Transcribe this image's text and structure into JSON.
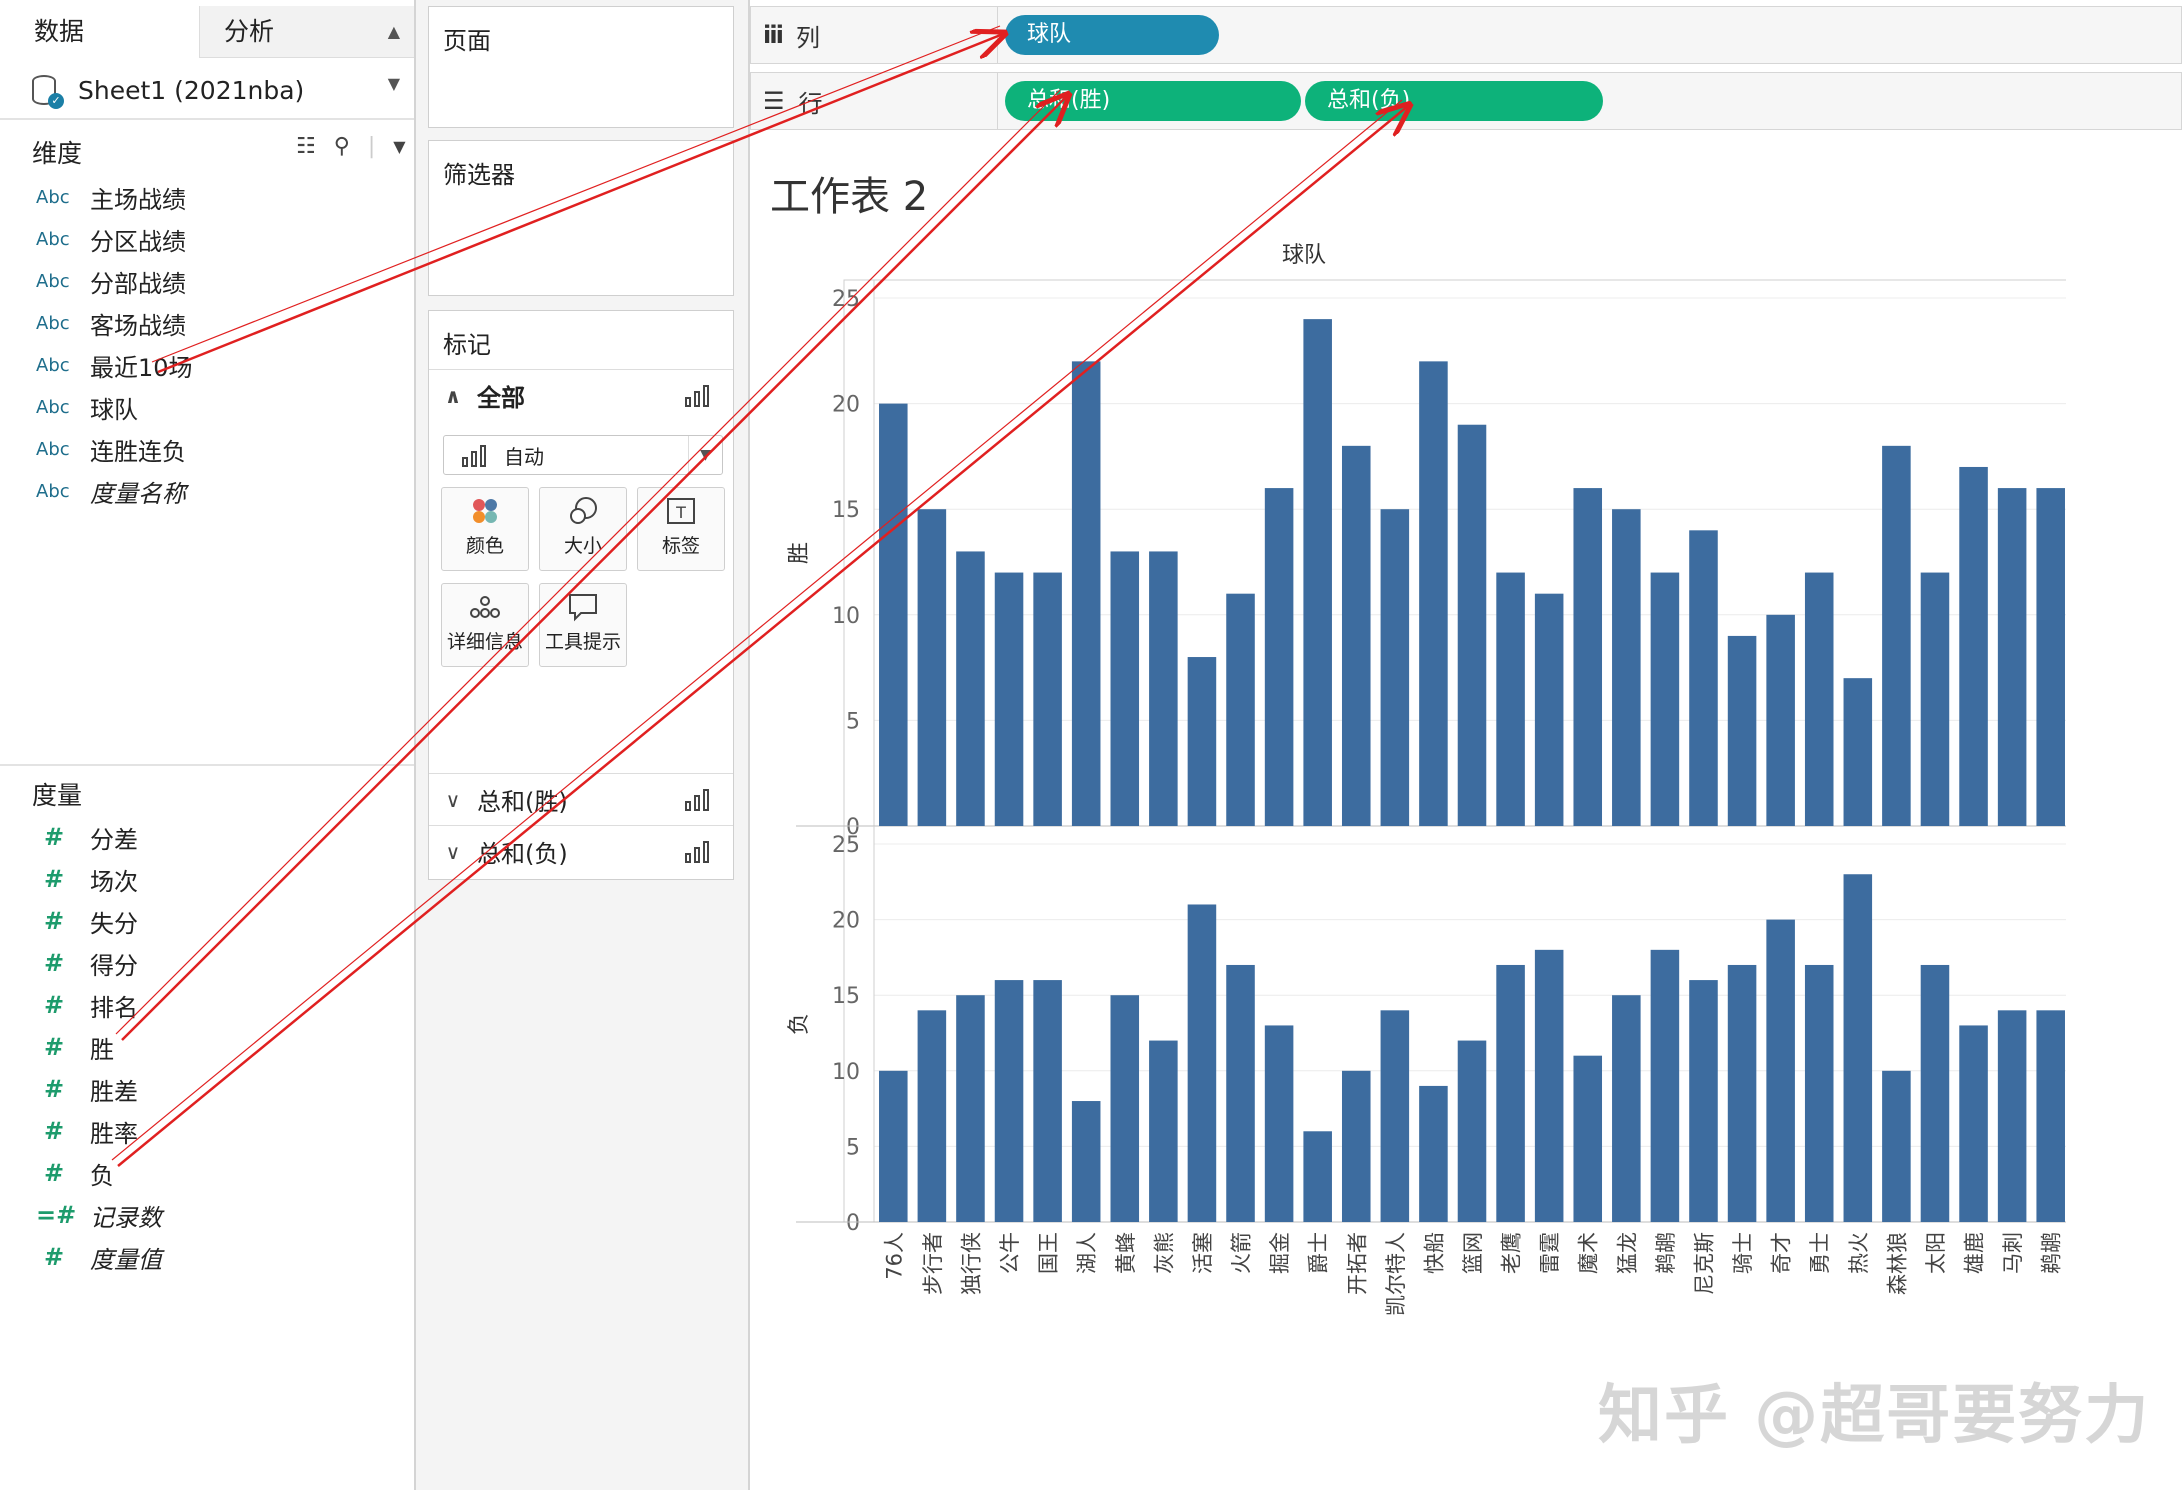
{
  "data_pane": {
    "tabs": {
      "data": "数据",
      "analysis": "分析"
    },
    "datasource": "Sheet1 (2021nba)",
    "dimensions_title": "维度",
    "dimensions": [
      {
        "type": "Abc",
        "name": "主场战绩"
      },
      {
        "type": "Abc",
        "name": "分区战绩"
      },
      {
        "type": "Abc",
        "name": "分部战绩"
      },
      {
        "type": "Abc",
        "name": "客场战绩"
      },
      {
        "type": "Abc",
        "name": "最近10场"
      },
      {
        "type": "Abc",
        "name": "球队"
      },
      {
        "type": "Abc",
        "name": "连胜连负"
      },
      {
        "type": "Abc",
        "name": "度量名称"
      }
    ],
    "measures_title": "度量",
    "measures": [
      {
        "type": "#",
        "name": "分差"
      },
      {
        "type": "#",
        "name": "场次"
      },
      {
        "type": "#",
        "name": "失分"
      },
      {
        "type": "#",
        "name": "得分"
      },
      {
        "type": "#",
        "name": "排名"
      },
      {
        "type": "#",
        "name": "胜"
      },
      {
        "type": "#",
        "name": "胜差"
      },
      {
        "type": "#",
        "name": "胜率"
      },
      {
        "type": "#",
        "name": "负"
      },
      {
        "type": "=#",
        "name": "记录数"
      },
      {
        "type": "#",
        "name": "度量值"
      }
    ]
  },
  "cards": {
    "pages": "页面",
    "filters": "筛选器",
    "marks": "标记",
    "marks_all": "全部",
    "mark_type": "自动",
    "mark_buttons": {
      "color": "颜色",
      "size": "大小",
      "label": "标签",
      "detail": "详细信息",
      "tooltip": "工具提示"
    },
    "sum_win": "总和(胜)",
    "sum_loss": "总和(负)"
  },
  "shelves": {
    "columns_label": "列",
    "rows_label": "行",
    "column_pill": "球队",
    "row_pills": [
      "总和(胜)",
      "总和(负)"
    ]
  },
  "sheet": {
    "title": "工作表 2"
  },
  "watermark": "知乎 @超哥要努力",
  "colors": {
    "bar": "#3d6c9f",
    "pill_dimension": "#1f8bb0",
    "pill_measure": "#0db27a",
    "annotation": "#e02020"
  },
  "chart_data": {
    "type": "bar",
    "header": "球队",
    "categories": [
      "76人",
      "步行者",
      "独行侠",
      "公牛",
      "国王",
      "湖人",
      "黄蜂",
      "灰熊",
      "活塞",
      "火箭",
      "掘金",
      "爵士",
      "开拓者",
      "凯尔特人",
      "快船",
      "篮网",
      "老鹰",
      "雷霆",
      "魔术",
      "猛龙",
      "鹈鹕",
      "尼克斯",
      "骑士",
      "奇才",
      "勇士",
      "热火",
      "森林狼",
      "太阳",
      "雄鹿",
      "马刺",
      "鹈鹕"
    ],
    "series": [
      {
        "name": "胜",
        "values": [
          20,
          15,
          13,
          12,
          12,
          22,
          13,
          13,
          8,
          11,
          16,
          24,
          18,
          15,
          22,
          19,
          12,
          11,
          16,
          15,
          12,
          14,
          9,
          10,
          12,
          7,
          18,
          12,
          17,
          16,
          16
        ]
      },
      {
        "name": "负",
        "values": [
          10,
          14,
          15,
          16,
          16,
          8,
          15,
          12,
          21,
          17,
          13,
          6,
          10,
          14,
          9,
          12,
          17,
          18,
          11,
          15,
          18,
          16,
          17,
          20,
          17,
          23,
          10,
          17,
          13,
          14,
          14
        ]
      }
    ],
    "ylim": [
      0,
      25
    ],
    "yticks": [
      0,
      5,
      10,
      15,
      20,
      25
    ],
    "grid": true
  }
}
